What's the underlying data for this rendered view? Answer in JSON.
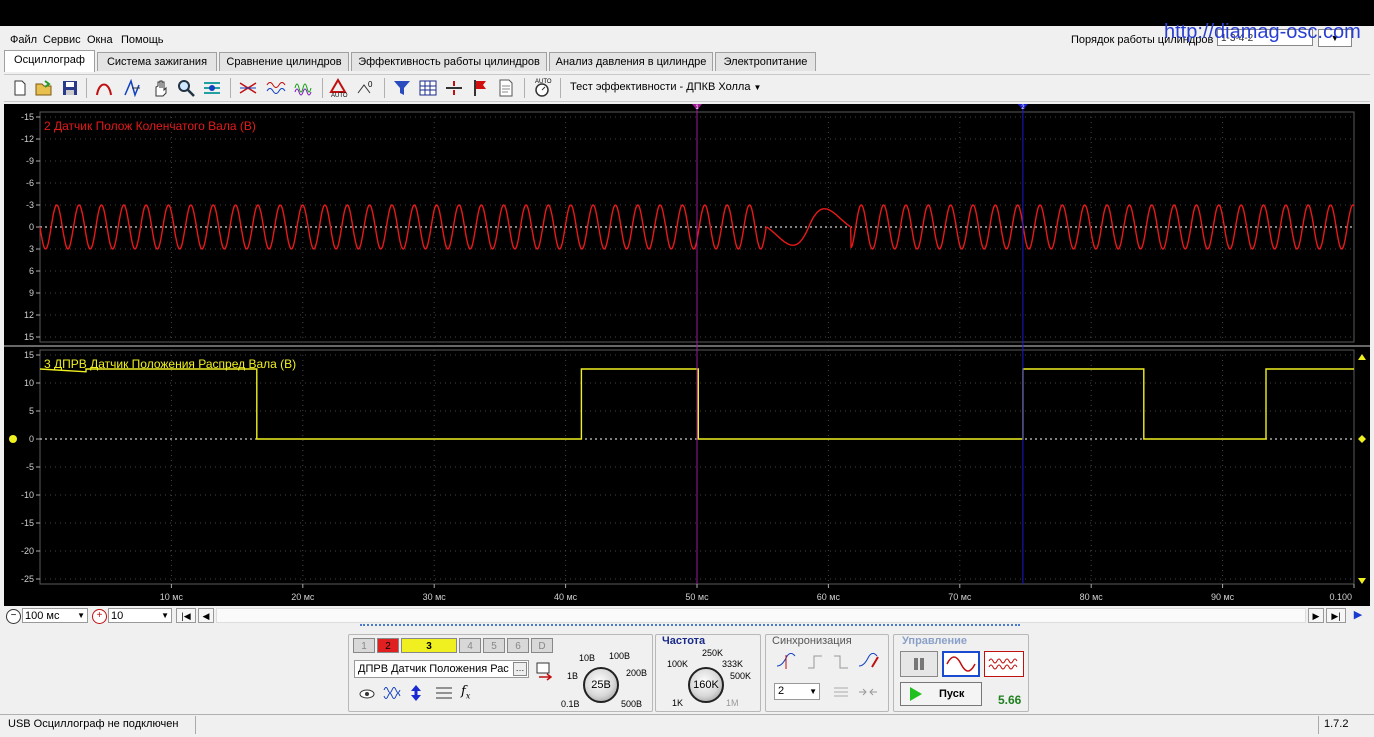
{
  "watermark": "http://diamag-osc.com",
  "menu": [
    "Файл",
    "Сервис",
    "Окна",
    "Помощь"
  ],
  "firing_order": {
    "label": "Порядок работы цилиндров",
    "value": "1-3-4-2"
  },
  "tabs": [
    "Осциллограф",
    "Система зажигания",
    "Сравнение цилиндров",
    "Эффективность работы цилиндров",
    "Анализ давления в цилиндре",
    "Электропитание"
  ],
  "toolbar": {
    "preset_label": "Тест эффективности - ДПКВ Холла"
  },
  "cursors": [
    "1",
    "2"
  ],
  "chart_data": [
    {
      "type": "line",
      "title": "2 Датчик Полож Коленчатого Вала (В)",
      "color": "#e81919",
      "y_ticks": [
        "-15",
        "-12",
        "-9",
        "-6",
        "-3",
        "0",
        "3",
        "6",
        "9",
        "12",
        "15"
      ],
      "ylim": [
        -15,
        15
      ],
      "y_inverted": true,
      "signal": {
        "kind": "sine",
        "amplitude": 3,
        "offset": 0,
        "cycles_per_10ms": 5.88,
        "missing_tooth_at_ms": 58.5
      }
    },
    {
      "type": "line",
      "title": "3 ДПРВ Датчик Положения Распред Вала (В)",
      "color": "#f0f020",
      "y_ticks": [
        "15",
        "10",
        "5",
        "0",
        "-5",
        "-10",
        "-15",
        "-20",
        "-25"
      ],
      "ylim": [
        -25,
        15
      ],
      "x": [
        0,
        3.5,
        3.5,
        16.5,
        16.5,
        41.2,
        41.2,
        50.1,
        50.1,
        74.8,
        74.8,
        84.0,
        84.0,
        93.3,
        93.3,
        100
      ],
      "y": [
        12.5,
        12.0,
        12.5,
        12.5,
        0,
        0,
        12.5,
        12.5,
        0,
        0,
        12.5,
        12.5,
        0,
        0,
        12.5,
        12.5
      ]
    }
  ],
  "x_axis": {
    "ticks": [
      "10 мс",
      "20 мс",
      "30 мс",
      "40 мс",
      "50 мс",
      "60 мс",
      "70 мс",
      "80 мс",
      "90 мс",
      "0.100"
    ],
    "xlim": [
      0,
      100
    ],
    "grid": true
  },
  "cursor_positions_ms": [
    50.0,
    74.8
  ],
  "timebase": {
    "value": "100 мс",
    "zoom": "10"
  },
  "channels": {
    "buttons": [
      "1",
      "2",
      "3",
      "4",
      "5",
      "6",
      "D"
    ],
    "active": "3",
    "name": "ДПРВ Датчик Положения Рас"
  },
  "volt_knob": {
    "value": "25В",
    "labels": [
      "10В",
      "100В",
      "1В",
      "200В",
      "0.1В",
      "500В"
    ]
  },
  "freq_knob": {
    "title": "Частота",
    "value": "160K",
    "labels": [
      "250K",
      "100K",
      "333K",
      "500K",
      "1K",
      "1M"
    ]
  },
  "sync": {
    "title": "Синхронизация",
    "channel": "2"
  },
  "control": {
    "title": "Управление",
    "start_label": "Пуск",
    "value": "5.66"
  },
  "status": {
    "text": "USB Осциллограф не подключен",
    "version": "1.7.2"
  }
}
